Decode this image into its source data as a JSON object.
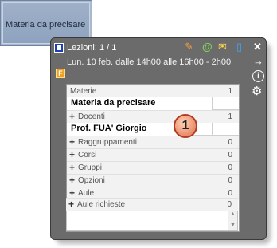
{
  "calendar": {
    "lesson_tile_label": "Materia da precisare"
  },
  "popup": {
    "title": "Lezioni: 1 / 1",
    "datetime": "Lun. 10 feb. dalle 14h00 alle 16h00 - 2h00",
    "badge": "F",
    "header_icons": [
      "edit-icon",
      "at-icon",
      "mail-icon",
      "phone-icon",
      "close-icon"
    ],
    "side_icons": [
      "arrow-right-icon",
      "info-icon",
      "gear-icon"
    ]
  },
  "panel": {
    "rows": [
      {
        "label": "Materie",
        "count": "1",
        "kind": "header",
        "expand": false
      },
      {
        "label": "Materia da precisare",
        "kind": "value"
      },
      {
        "label": "Docenti",
        "count": "1",
        "kind": "header",
        "expand": true
      },
      {
        "label": "Prof. FUA' Giorgio",
        "kind": "value"
      },
      {
        "label": "Raggruppamenti",
        "count": "0",
        "kind": "header",
        "expand": true
      },
      {
        "label": "Corsi",
        "count": "0",
        "kind": "header",
        "expand": true
      },
      {
        "label": "Gruppi",
        "count": "0",
        "kind": "header",
        "expand": true
      },
      {
        "label": "Opzioni",
        "count": "0",
        "kind": "header",
        "expand": true
      },
      {
        "label": "Aule",
        "count": "0",
        "kind": "header",
        "expand": true
      },
      {
        "label": "Aule richieste",
        "count": "0",
        "kind": "header",
        "expand": true
      }
    ],
    "memo_text": ""
  },
  "callout": {
    "number": "1"
  },
  "colors": {
    "popup_bg": "#6b6b6b",
    "tile_bg": "#9fb0c8",
    "callout_border": "#b23b22",
    "badge": "#f0a020"
  }
}
